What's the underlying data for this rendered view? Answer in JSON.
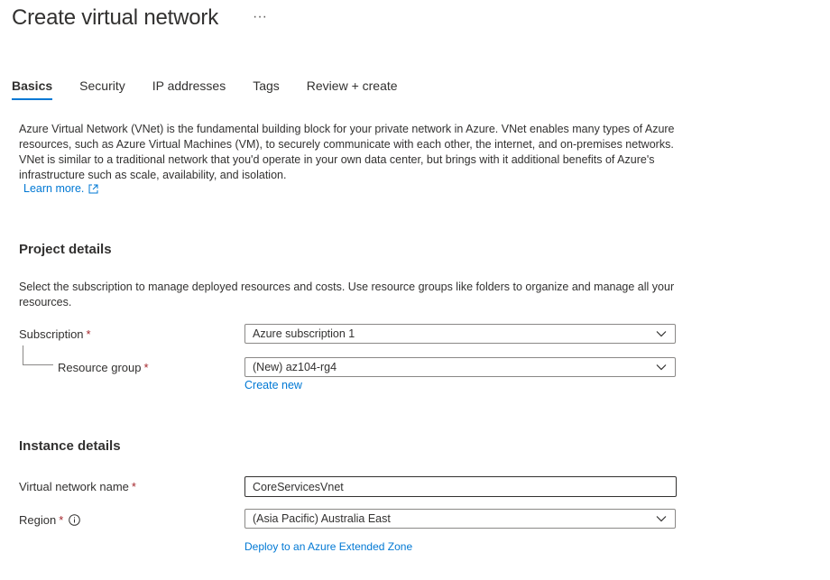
{
  "header": {
    "title": "Create virtual network",
    "more_label": "···"
  },
  "tabs": [
    {
      "label": "Basics",
      "active": true
    },
    {
      "label": "Security",
      "active": false
    },
    {
      "label": "IP addresses",
      "active": false
    },
    {
      "label": "Tags",
      "active": false
    },
    {
      "label": "Review + create",
      "active": false
    }
  ],
  "intro": {
    "text": "Azure Virtual Network (VNet) is the fundamental building block for your private network in Azure. VNet enables many types of Azure resources, such as Azure Virtual Machines (VM), to securely communicate with each other, the internet, and on-premises networks. VNet is similar to a traditional network that you'd operate in your own data center, but brings with it additional benefits of Azure's infrastructure such as scale, availability, and isolation.",
    "learn_more": "Learn more."
  },
  "project": {
    "heading": "Project details",
    "description": "Select the subscription to manage deployed resources and costs. Use resource groups like folders to organize and manage all your resources.",
    "subscription_label": "Subscription",
    "subscription_value": "Azure subscription 1",
    "resource_group_label": "Resource group",
    "resource_group_value": "(New) az104-rg4",
    "create_new": "Create new"
  },
  "instance": {
    "heading": "Instance details",
    "vnet_name_label": "Virtual network name",
    "vnet_name_value": "CoreServicesVnet",
    "region_label": "Region",
    "region_value": "(Asia Pacific) Australia East",
    "extended_zone_link": "Deploy to an Azure Extended Zone"
  },
  "required_marker": "*",
  "colors": {
    "accent": "#0078d4",
    "required": "#a4262c",
    "text": "#323130"
  }
}
